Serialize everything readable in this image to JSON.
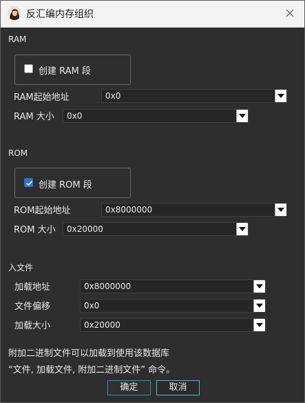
{
  "window": {
    "title": "反汇编内存组织",
    "avatar_icon": "avatar-icon",
    "close_icon": "close-icon"
  },
  "ram": {
    "section_title": "RAM",
    "create_label": "创建 RAM 段",
    "create_checked": false,
    "start_label": "RAM起始地址",
    "start_value": "0x0",
    "size_label": "RAM 大小",
    "size_value": "0x0"
  },
  "rom": {
    "section_title": "ROM",
    "create_label": "创建 ROM 段",
    "create_checked": true,
    "start_label": "ROM起始地址",
    "start_value": "0x8000000",
    "size_label": "ROM 大小",
    "size_value": "0x20000"
  },
  "input_file": {
    "section_title": "入文件",
    "load_addr_label": "加载地址",
    "load_addr_value": "0x8000000",
    "offset_label": "文件偏移",
    "offset_value": "0x0",
    "load_size_label": "加载大小",
    "load_size_value": "0x20000"
  },
  "note": {
    "line1": "附加二进制文件可以加载到使用该数据库",
    "line2": "“文件, 加载文件, 附加二进制文件” 命令。"
  },
  "buttons": {
    "ok": "确定",
    "cancel": "取消"
  },
  "colors": {
    "accent": "#2f6fd0",
    "button_border": "#1f9fa0",
    "background": "#2e2e2e"
  }
}
